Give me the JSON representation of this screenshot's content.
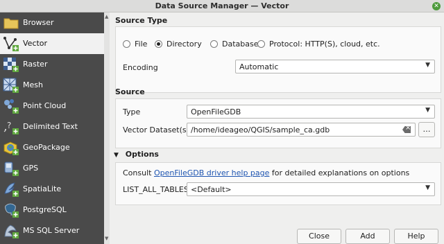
{
  "window": {
    "title": "Data Source Manager — Vector"
  },
  "sidebar": {
    "items": [
      {
        "label": "Browser",
        "icon": "folder-icon"
      },
      {
        "label": "Vector",
        "icon": "vector-add-icon",
        "selected": true
      },
      {
        "label": "Raster",
        "icon": "raster-add-icon"
      },
      {
        "label": "Mesh",
        "icon": "mesh-add-icon"
      },
      {
        "label": "Point Cloud",
        "icon": "point-cloud-add-icon"
      },
      {
        "label": "Delimited Text",
        "icon": "delimited-text-add-icon"
      },
      {
        "label": "GeoPackage",
        "icon": "geopackage-add-icon"
      },
      {
        "label": "GPS",
        "icon": "gps-add-icon"
      },
      {
        "label": "SpatiaLite",
        "icon": "spatialite-add-icon"
      },
      {
        "label": "PostgreSQL",
        "icon": "postgresql-add-icon"
      },
      {
        "label": "MS SQL Server",
        "icon": "mssql-add-icon"
      }
    ]
  },
  "source_type": {
    "heading": "Source Type",
    "options": [
      "File",
      "Directory",
      "Database",
      "Protocol: HTTP(S), cloud, etc."
    ],
    "selected": "Directory",
    "encoding_label": "Encoding",
    "encoding_value": "Automatic"
  },
  "source": {
    "heading": "Source",
    "type_label": "Type",
    "type_value": "OpenFileGDB",
    "dataset_label": "Vector Dataset(s)",
    "dataset_value": "/home/ideageo/QGIS/sample_ca.gdb",
    "browse_label": "…"
  },
  "options": {
    "heading": "Options",
    "consult_prefix": "Consult",
    "consult_link": "OpenFileGDB driver help page",
    "consult_suffix": "for detailed explanations on options",
    "list_label": "LIST_ALL_TABLES",
    "list_value": "<Default>"
  },
  "buttons": {
    "close": "Close",
    "add": "Add",
    "help": "Help"
  }
}
